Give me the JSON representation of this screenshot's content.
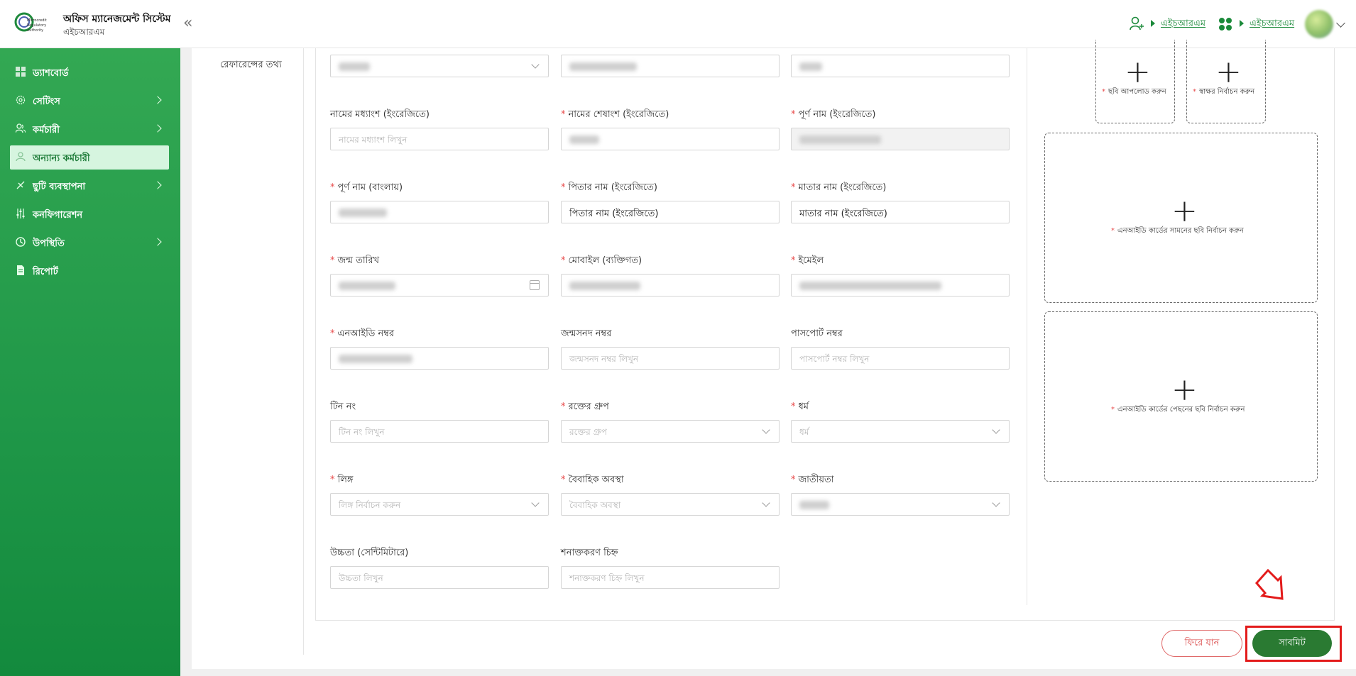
{
  "header": {
    "app_title": "অফিস ম্যানেজমেন্ট সিস্টেম",
    "app_subtitle": "এইচআরএম",
    "link_1": "এইচআরএম",
    "link_2": "এইচআরএম"
  },
  "sidebar": {
    "items": [
      {
        "label": "ড্যাশবোর্ড",
        "icon": "dashboard-icon"
      },
      {
        "label": "সেটিংস",
        "icon": "gear-icon"
      },
      {
        "label": "কর্মচারী",
        "icon": "users-icon"
      },
      {
        "label": "অন্যান্য কর্মচারী",
        "icon": "user-icon"
      },
      {
        "label": "ছুটি ব্যবস্থাপনা",
        "icon": "leave-icon"
      },
      {
        "label": "কনফিগারেশন",
        "icon": "sliders-icon"
      },
      {
        "label": "উপস্থিতি",
        "icon": "clock-icon"
      },
      {
        "label": "রিপোর্ট",
        "icon": "report-icon"
      }
    ]
  },
  "form": {
    "section_label": "রেফারেন্সের তথ্য",
    "middle_name_en": {
      "label": "নামের মধ্যাংশ (ইংরেজিতে)",
      "placeholder": "নামের মধ্যাংশ লিখুন"
    },
    "last_name_en": {
      "label": "নামের শেষাংশ (ইংরেজিতে)"
    },
    "full_name_en": {
      "label": "পূর্ণ নাম (ইংরেজিতে)"
    },
    "full_name_bn": {
      "label": "পূর্ণ নাম (বাংলায়)"
    },
    "father_name_en": {
      "label": "পিতার নাম (ইংরেজিতে)",
      "value": "পিতার নাম (ইংরেজিতে)"
    },
    "mother_name_en": {
      "label": "মাতার নাম (ইংরেজিতে)",
      "value": "মাতার নাম (ইংরেজিতে)"
    },
    "dob": {
      "label": "জন্ম তারিখ"
    },
    "mobile": {
      "label": "মোবাইল (ব্যক্তিগত)"
    },
    "email": {
      "label": "ইমেইল"
    },
    "nid": {
      "label": "এনআইডি নম্বর"
    },
    "birth_cert": {
      "label": "জন্মসনদ নম্বর",
      "placeholder": "জন্মসনদ নম্বর লিখুন"
    },
    "passport": {
      "label": "পাসপোর্ট নম্বর",
      "placeholder": "পাসপোর্ট নম্বর লিখুন"
    },
    "tin": {
      "label": "টিন নং",
      "placeholder": "টিন নং লিখুন"
    },
    "blood_group": {
      "label": "রক্তের গ্রুপ",
      "placeholder": "রক্তের গ্রুপ"
    },
    "religion": {
      "label": "ধর্ম",
      "placeholder": "ধর্ম"
    },
    "gender": {
      "label": "লিঙ্গ",
      "placeholder": "লিঙ্গ নির্বাচন করুন"
    },
    "marital": {
      "label": "বৈবাহিক অবস্থা",
      "placeholder": "বৈবাহিক অবস্থা"
    },
    "nationality": {
      "label": "জাতীয়তা"
    },
    "height": {
      "label": "উচ্চতা (সেন্টিমিটারে)",
      "placeholder": "উচ্চতা লিখুন"
    },
    "identification_mark": {
      "label": "শনাক্তকরণ চিহ্ন",
      "placeholder": "শনাক্তকরণ চিহ্ন লিখুন"
    }
  },
  "uploads": {
    "photo": "ছবি আপলোড করুন",
    "signature": "স্বাক্ষর নির্বাচন করুন",
    "nid_front": "এনআইডি কার্ডের সামনের ছবি নির্বাচন করুন",
    "nid_back": "এনআইডি কার্ডের পেছনের ছবি নির্বাচন করুন"
  },
  "actions": {
    "back": "ফিরে যান",
    "submit": "সাবমিট"
  },
  "colors": {
    "brand_green": "#1f9748",
    "submit_green": "#2a7a32",
    "required_red": "#e84a4a",
    "highlight_red": "#e31b1b"
  }
}
